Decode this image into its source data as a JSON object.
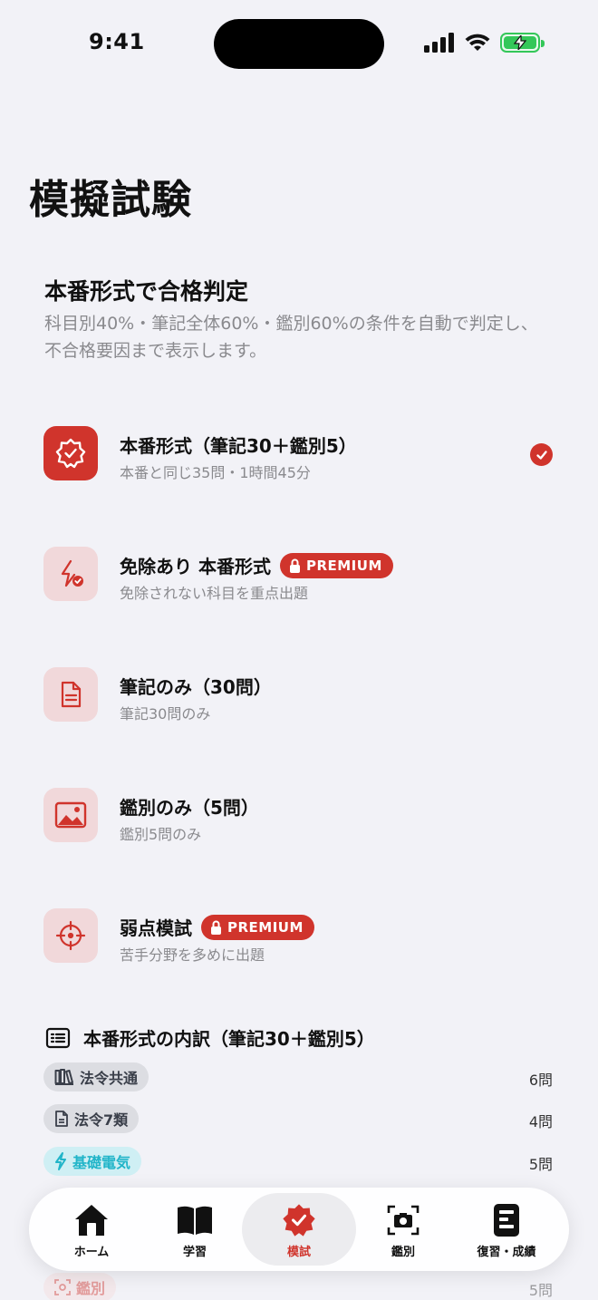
{
  "status": {
    "time": "9:41"
  },
  "page": {
    "title": "模擬試験"
  },
  "intro": {
    "title": "本番形式で合格判定",
    "description": "科目別40%・筆記全体60%・鑑別60%の条件を自動で判定し、不合格要因まで表示します。"
  },
  "modes": [
    {
      "name": "本番形式（筆記30＋鑑別5）",
      "sub": "本番と同じ35問・1時間45分",
      "icon": "seal-check-icon",
      "selected": true,
      "premium": false
    },
    {
      "name": "免除あり 本番形式",
      "sub": "免除されない科目を重点出題",
      "icon": "bolt-check-icon",
      "selected": false,
      "premium": true,
      "badge": "PREMIUM"
    },
    {
      "name": "筆記のみ（30問）",
      "sub": "筆記30問のみ",
      "icon": "document-icon",
      "selected": false,
      "premium": false
    },
    {
      "name": "鑑別のみ（5問）",
      "sub": "鑑別5問のみ",
      "icon": "image-icon",
      "selected": false,
      "premium": false
    },
    {
      "name": "弱点模試",
      "sub": "苦手分野を多めに出題",
      "icon": "crosshair-icon",
      "selected": false,
      "premium": true,
      "badge": "PREMIUM"
    }
  ],
  "breakdown": {
    "title": "本番形式の内訳（筆記30＋鑑別5）",
    "rows": [
      {
        "label": "法令共通",
        "count": "6問",
        "icon": "books-icon",
        "color": "#3a3f4a"
      },
      {
        "label": "法令7類",
        "count": "4問",
        "icon": "document-icon",
        "color": "#3a3f4a"
      },
      {
        "label": "基礎電気",
        "count": "5問",
        "icon": "bolt-icon",
        "color": "#22b5c9"
      },
      {
        "label": "鑑別",
        "count": "5問",
        "icon": "camera-scan-icon",
        "color": "#d0342c"
      }
    ]
  },
  "tabs": [
    {
      "label": "ホーム",
      "icon": "home-icon"
    },
    {
      "label": "学習",
      "icon": "book-icon"
    },
    {
      "label": "模試",
      "icon": "seal-check-icon",
      "active": true
    },
    {
      "label": "鑑別",
      "icon": "camera-icon"
    },
    {
      "label": "復習・成績",
      "icon": "report-icon"
    }
  ],
  "colors": {
    "accent": "#d0342c",
    "tint": "#f1d8da",
    "background": "#f2f2f7",
    "secondary_text": "#8a8a8e"
  }
}
